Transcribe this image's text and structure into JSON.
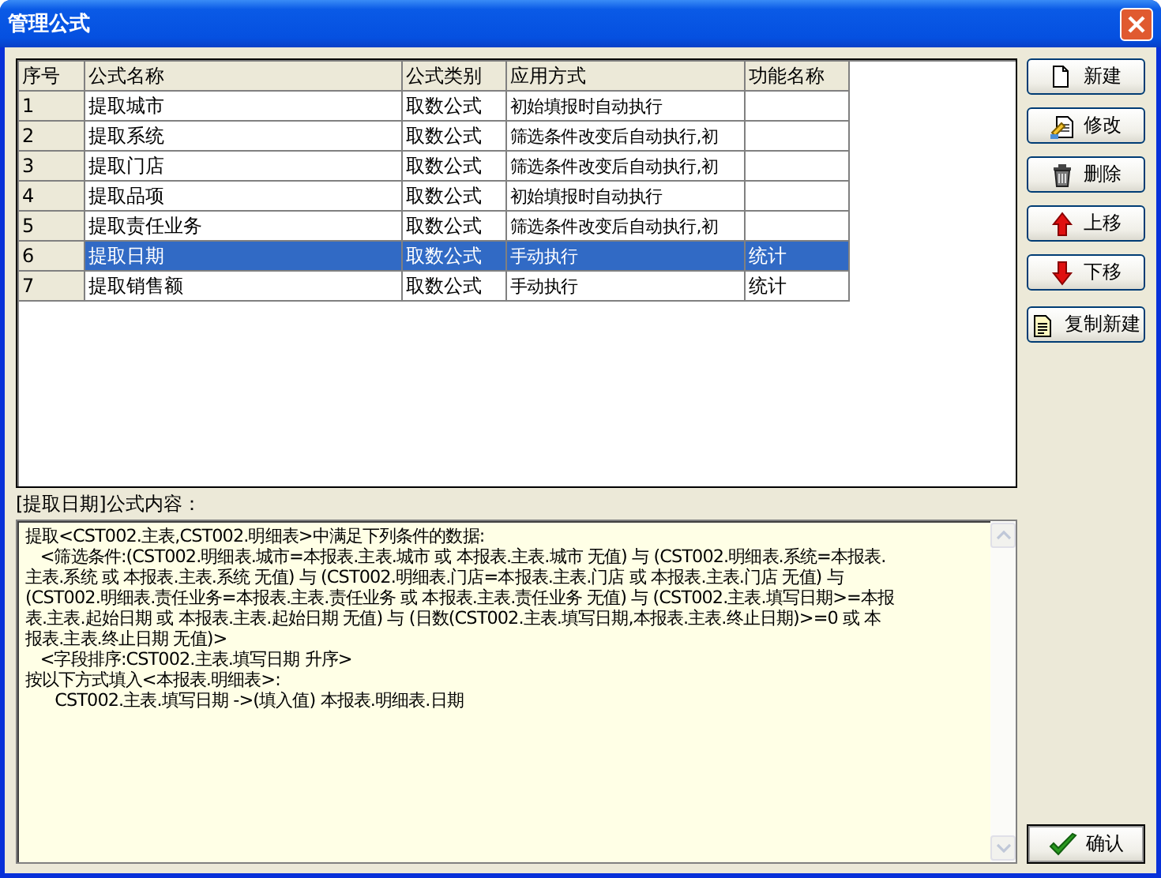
{
  "window": {
    "title": "管理公式"
  },
  "table": {
    "columns": [
      "序号",
      "公式名称",
      "公式类别",
      "应用方式",
      "功能名称"
    ],
    "rows": [
      {
        "cells": [
          "1",
          "提取城市",
          "取数公式",
          "初始填报时自动执行",
          ""
        ],
        "selected": false
      },
      {
        "cells": [
          "2",
          "提取系统",
          "取数公式",
          "筛选条件改变后自动执行,初",
          ""
        ],
        "selected": false
      },
      {
        "cells": [
          "3",
          "提取门店",
          "取数公式",
          "筛选条件改变后自动执行,初",
          ""
        ],
        "selected": false
      },
      {
        "cells": [
          "4",
          "提取品项",
          "取数公式",
          "初始填报时自动执行",
          ""
        ],
        "selected": false
      },
      {
        "cells": [
          "5",
          "提取责任业务",
          "取数公式",
          "筛选条件改变后自动执行,初",
          ""
        ],
        "selected": false
      },
      {
        "cells": [
          "6",
          "提取日期",
          "取数公式",
          "手动执行",
          "统计"
        ],
        "selected": true
      },
      {
        "cells": [
          "7",
          "提取销售额",
          "取数公式",
          "手动执行",
          "统计"
        ],
        "selected": false
      }
    ]
  },
  "buttons": [
    {
      "label": "新建",
      "kind": "new"
    },
    {
      "label": "修改",
      "kind": "edit"
    },
    {
      "label": "删除",
      "kind": "delete"
    },
    {
      "label": "上移",
      "kind": "up"
    },
    {
      "label": "下移",
      "kind": "down"
    },
    {
      "label": "复制新建",
      "kind": "copy"
    }
  ],
  "content_label": "[提取日期]公式内容：",
  "content_lines": [
    "提取<CST002.主表,CST002.明细表>中满足下列条件的数据:",
    "   <筛选条件:(CST002.明细表.城市=本报表.主表.城市 或 本报表.主表.城市 无值) 与 (CST002.明细表.系统=本报表.",
    "主表.系统 或 本报表.主表.系统 无值) 与 (CST002.明细表.门店=本报表.主表.门店 或 本报表.主表.门店 无值) 与",
    "(CST002.明细表.责任业务=本报表.主表.责任业务 或 本报表.主表.责任业务 无值) 与 (CST002.主表.填写日期>=本报",
    "表.主表.起始日期 或 本报表.主表.起始日期 无值) 与 (日数(CST002.主表.填写日期,本报表.主表.终止日期)>=0 或 本",
    "报表.主表.终止日期 无值)>",
    "   <字段排序:CST002.主表.填写日期 升序>",
    "按以下方式填入<本报表.明细表>:",
    "      CST002.主表.填写日期 ->(填入值) 本报表.明细表.日期"
  ],
  "ok_button": {
    "label": "确认"
  }
}
